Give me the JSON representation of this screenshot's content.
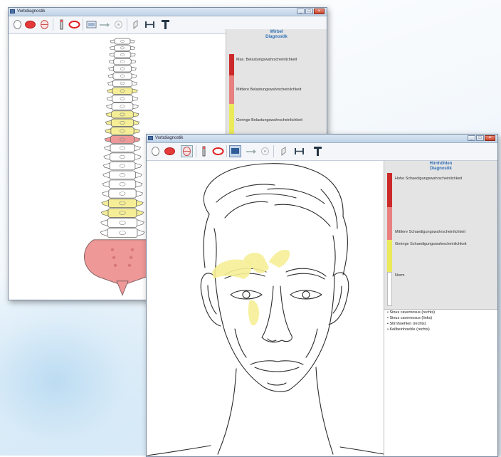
{
  "colors": {
    "high": "#cc2a2a",
    "medium": "#e98080",
    "low": "#eaea5a",
    "norm": "#ffffff",
    "highlight_yellow": "#f5ee96",
    "highlight_red": "#ee9898",
    "accent_blue": "#2f6fb6"
  },
  "spine_window": {
    "title": "Vorbdiagnostik",
    "toolbar_icons": [
      "ellipse-outline-icon",
      "ellipse-filled-icon",
      "ellipse-hatched-icon",
      "pen-icon",
      "ring-icon",
      "camera-icon",
      "arrow-icon",
      "target-icon",
      "pointer-icon",
      "ruler-icon",
      "sound-fork-icon"
    ],
    "legend": {
      "heading_line1": "Wirbel",
      "heading_line2": "Diagnostik",
      "items": [
        {
          "label": "Max. Belastungswahrscheinlichkeit"
        },
        {
          "label": "Mittlere Belastungswahrscheinlichkeit"
        },
        {
          "label": "Geringe Belastungswahrscheinlichkeit"
        }
      ]
    }
  },
  "head_window": {
    "title": "Vorbdiagnostik",
    "toolbar_icons": [
      "ellipse-outline-icon",
      "ellipse-filled-icon",
      "ellipse-hatched-icon",
      "pen-icon",
      "ring-icon",
      "camera-icon",
      "arrow-icon",
      "target-icon",
      "pointer-icon",
      "ruler-icon",
      "sound-fork-icon"
    ],
    "legend": {
      "heading_line1": "Hirnhöhlen",
      "heading_line2": "Diagnostik",
      "items": [
        {
          "label": "Hohe Schaedigungswahrscheinlichkeit"
        },
        {
          "label": "Mittlere Schaedigungswahrscheinlichkeit"
        },
        {
          "label": "Geringe Schaedigungswahrscheinlichkeit"
        },
        {
          "label": "Norm"
        }
      ]
    },
    "findings": [
      "• Sinus cavernosus (rechts)",
      "• Sinus cavernosus (links)",
      "• Stirnhoehlen (rechts)",
      "• Keilbeinhoehle (rechts)"
    ]
  },
  "spine": {
    "vertebra_colors": [
      "w",
      "w",
      "w",
      "w",
      "w",
      "w",
      "w",
      "y",
      "w",
      "w",
      "y",
      "y",
      "y",
      "r",
      "w",
      "w",
      "w",
      "w",
      "w",
      "w",
      "y",
      "y",
      "w",
      "w"
    ]
  }
}
